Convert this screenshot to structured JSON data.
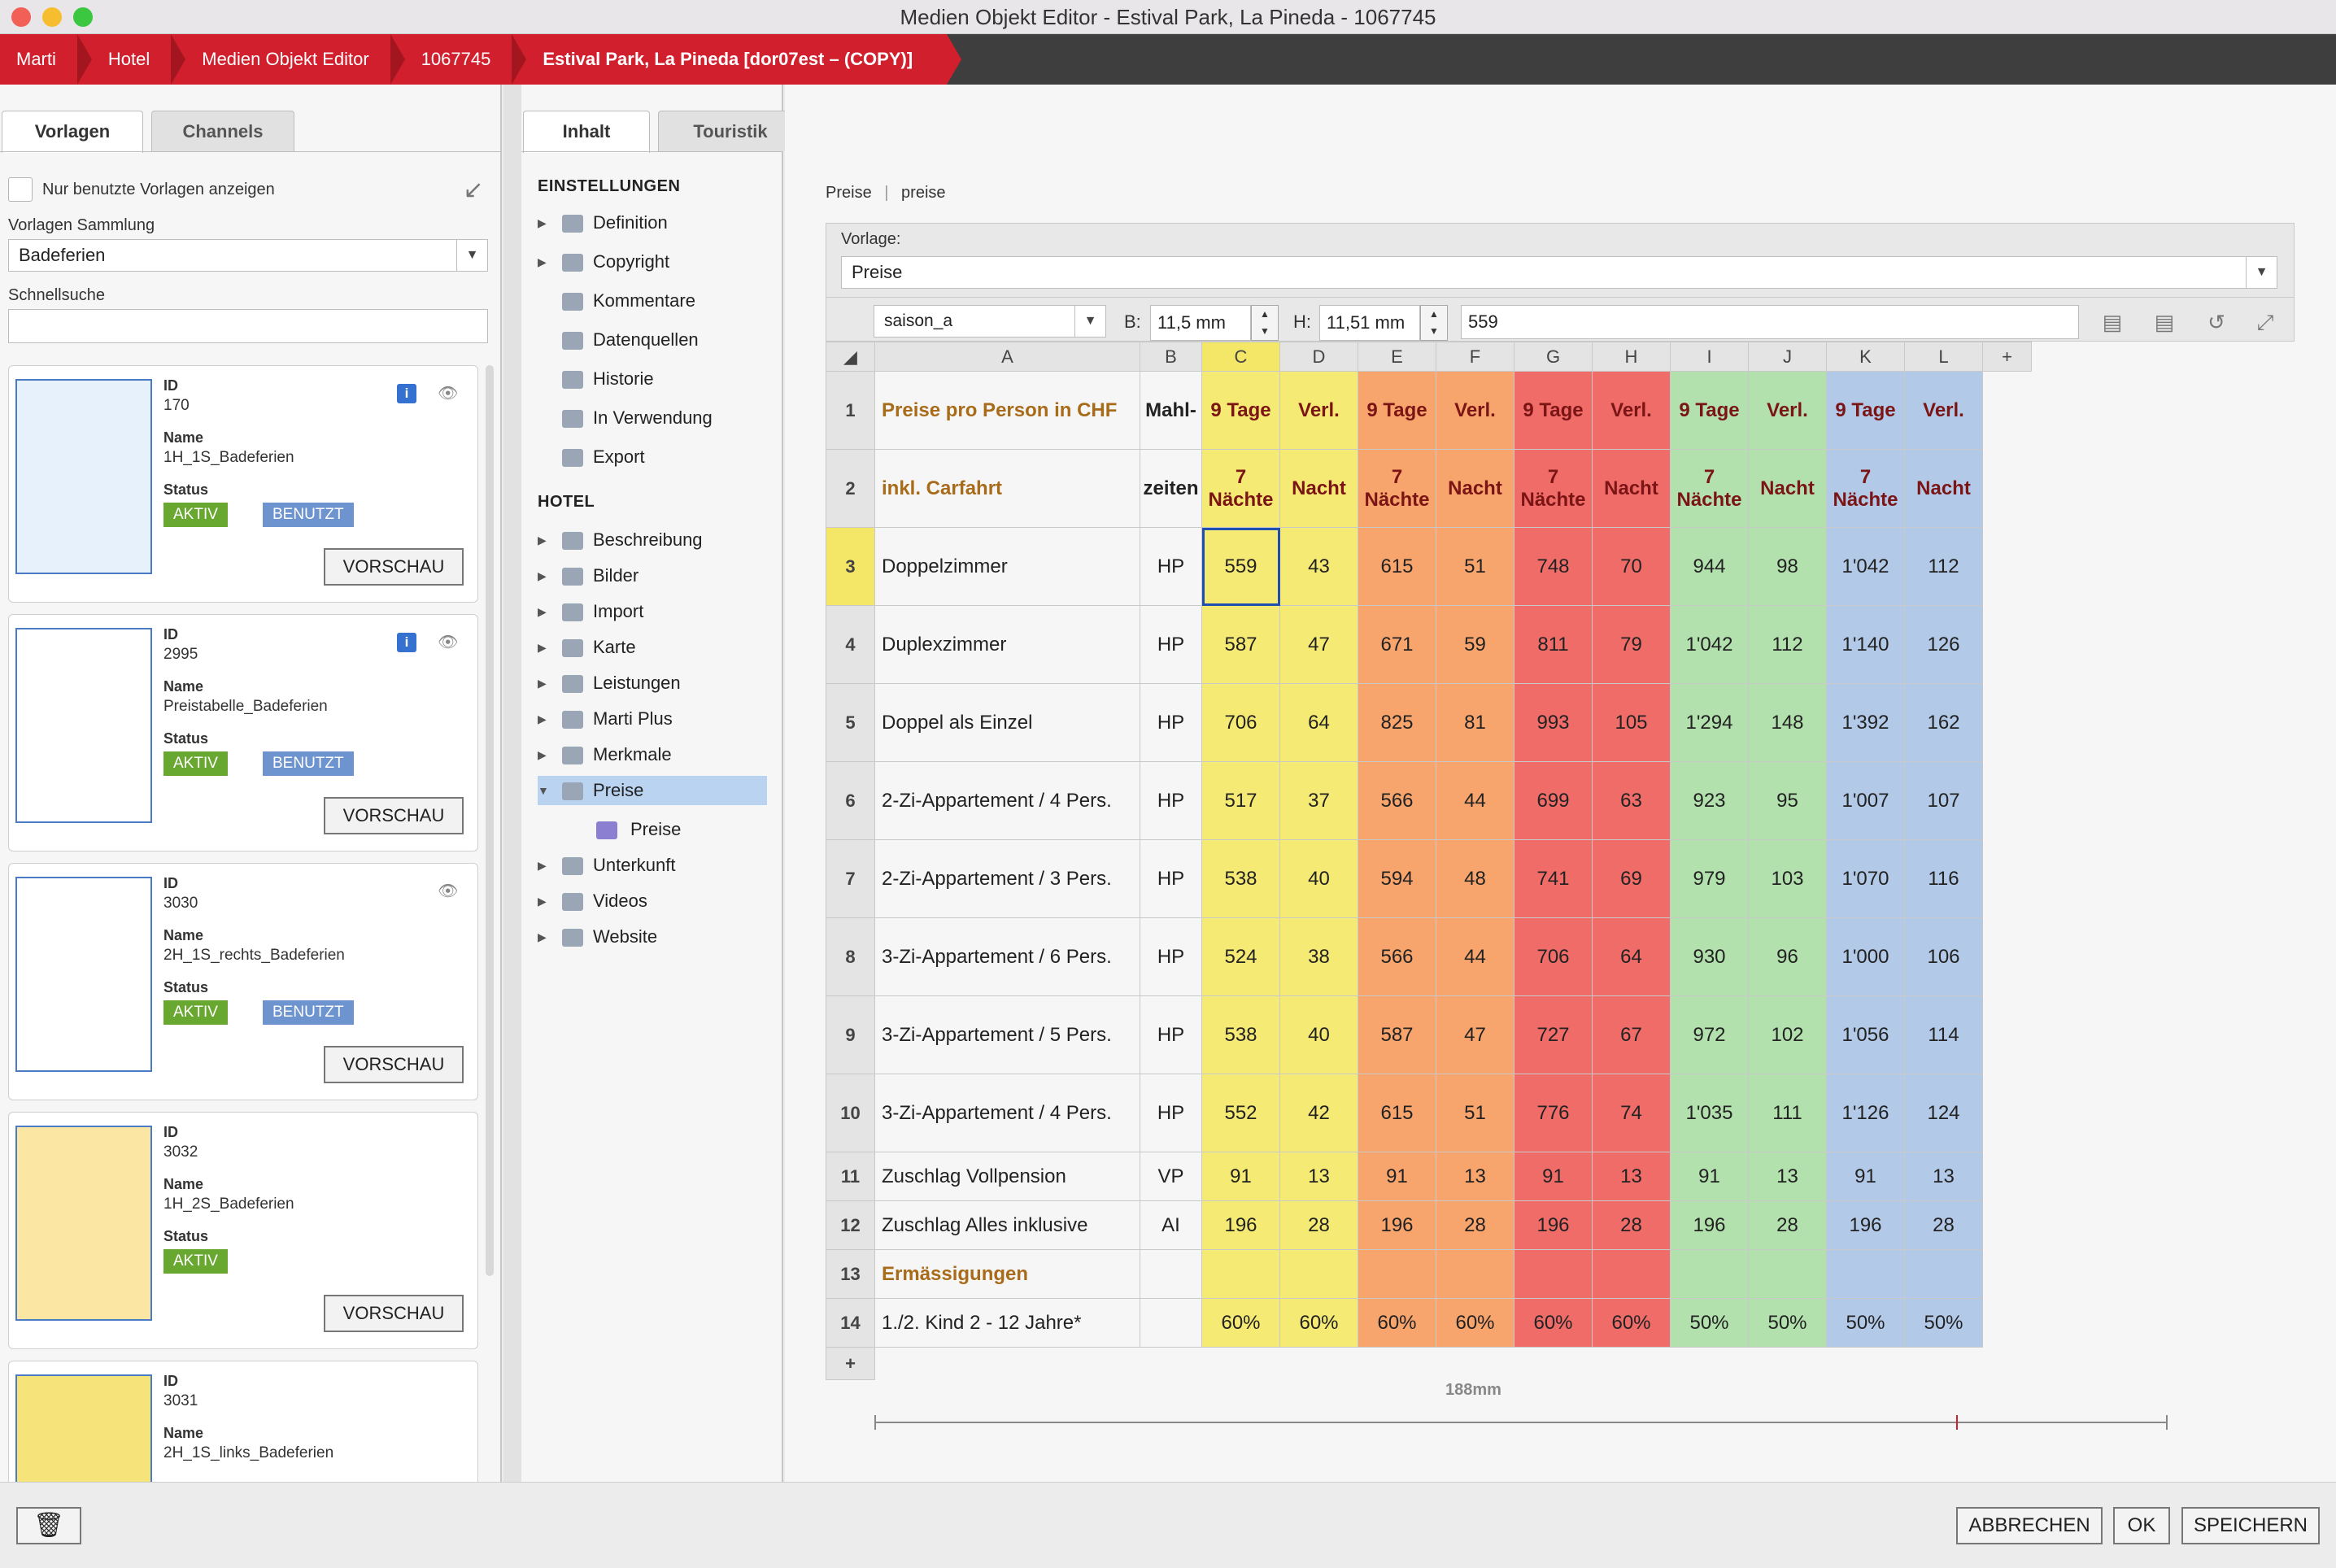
{
  "window": {
    "title": "Medien Objekt Editor - Estival Park, La Pineda - 1067745"
  },
  "breadcrumb": [
    "Marti",
    "Hotel",
    "Medien Objekt Editor",
    "1067745",
    "Estival Park, La Pineda [dor07est  – (COPY)]"
  ],
  "left": {
    "tabs": [
      "Vorlagen",
      "Channels"
    ],
    "only_used_label": "Nur benutzte Vorlagen anzeigen",
    "collection_label": "Vorlagen Sammlung",
    "collection_value": "Badeferien",
    "quicksearch_label": "Schnellsuche",
    "quicksearch_value": "",
    "field_labels": {
      "id": "ID",
      "name": "Name",
      "status": "Status"
    },
    "preview_label": "VORSCHAU",
    "cards": [
      {
        "id": "170",
        "name": "1H_1S_Badeferien",
        "status": [
          "AKTIV",
          "BENUTZT"
        ],
        "info": true
      },
      {
        "id": "2995",
        "name": "Preistabelle_Badeferien",
        "status": [
          "AKTIV",
          "BENUTZT"
        ],
        "info": true
      },
      {
        "id": "3030",
        "name": "2H_1S_rechts_Badeferien",
        "status": [
          "AKTIV",
          "BENUTZT"
        ],
        "info": false
      },
      {
        "id": "3032",
        "name": "1H_2S_Badeferien",
        "status": [
          "AKTIV"
        ],
        "info": false
      },
      {
        "id": "3031",
        "name": "2H_1S_links_Badeferien",
        "status": [],
        "info": false
      }
    ]
  },
  "middle": {
    "tabs": [
      "Inhalt",
      "Touristik"
    ],
    "section_settings": "EINSTELLUNGEN",
    "settings": [
      "Definition",
      "Copyright",
      "Kommentare",
      "Datenquellen",
      "Historie",
      "In Verwendung",
      "Export"
    ],
    "section_hotel": "HOTEL",
    "hotel": [
      "Beschreibung",
      "Bilder",
      "Import",
      "Karte",
      "Leistungen",
      "Marti Plus",
      "Merkmale",
      "Preise",
      "Unterkunft",
      "Videos",
      "Website"
    ],
    "selected": "Preise",
    "sub": "Preise"
  },
  "main": {
    "breadcrumb": [
      "Preise",
      "preise"
    ],
    "vorlage_label": "Vorlage:",
    "vorlage_value": "Preise",
    "cell_name": "saison_a",
    "width_label": "B:",
    "width_value": "11,5 mm",
    "height_label": "H:",
    "height_value": "11,51 mm",
    "formula": "559",
    "measure_label": "188mm",
    "columns": [
      "A",
      "B",
      "C",
      "D",
      "E",
      "F",
      "G",
      "H",
      "I",
      "J",
      "K",
      "L"
    ],
    "rows": [
      {
        "n": "1",
        "cells": [
          "Preise pro Person in CHF",
          "Mahl-",
          "9 Tage",
          "Verl.",
          "9 Tage",
          "Verl.",
          "9 Tage",
          "Verl.",
          "9 Tage",
          "Verl.",
          "9 Tage",
          "Verl."
        ]
      },
      {
        "n": "2",
        "cells": [
          "inkl. Carfahrt",
          "zeiten",
          "7 Nächte",
          "Nacht",
          "7 Nächte",
          "Nacht",
          "7 Nächte",
          "Nacht",
          "7 Nächte",
          "Nacht",
          "7 Nächte",
          "Nacht"
        ]
      },
      {
        "n": "3",
        "cells": [
          "Doppelzimmer",
          "HP",
          "559",
          "43",
          "615",
          "51",
          "748",
          "70",
          "944",
          "98",
          "1'042",
          "112"
        ]
      },
      {
        "n": "4",
        "cells": [
          "Duplexzimmer",
          "HP",
          "587",
          "47",
          "671",
          "59",
          "811",
          "79",
          "1'042",
          "112",
          "1'140",
          "126"
        ]
      },
      {
        "n": "5",
        "cells": [
          "Doppel als Einzel",
          "HP",
          "706",
          "64",
          "825",
          "81",
          "993",
          "105",
          "1'294",
          "148",
          "1'392",
          "162"
        ]
      },
      {
        "n": "6",
        "cells": [
          "2-Zi-Appartement / 4 Pers.",
          "HP",
          "517",
          "37",
          "566",
          "44",
          "699",
          "63",
          "923",
          "95",
          "1'007",
          "107"
        ]
      },
      {
        "n": "7",
        "cells": [
          "2-Zi-Appartement / 3 Pers.",
          "HP",
          "538",
          "40",
          "594",
          "48",
          "741",
          "69",
          "979",
          "103",
          "1'070",
          "116"
        ]
      },
      {
        "n": "8",
        "cells": [
          "3-Zi-Appartement / 6 Pers.",
          "HP",
          "524",
          "38",
          "566",
          "44",
          "706",
          "64",
          "930",
          "96",
          "1'000",
          "106"
        ]
      },
      {
        "n": "9",
        "cells": [
          "3-Zi-Appartement / 5 Pers.",
          "HP",
          "538",
          "40",
          "587",
          "47",
          "727",
          "67",
          "972",
          "102",
          "1'056",
          "114"
        ]
      },
      {
        "n": "10",
        "cells": [
          "3-Zi-Appartement / 4 Pers.",
          "HP",
          "552",
          "42",
          "615",
          "51",
          "776",
          "74",
          "1'035",
          "111",
          "1'126",
          "124"
        ]
      },
      {
        "n": "11",
        "cells": [
          "Zuschlag Vollpension",
          "VP",
          "91",
          "13",
          "91",
          "13",
          "91",
          "13",
          "91",
          "13",
          "91",
          "13"
        ]
      },
      {
        "n": "12",
        "cells": [
          "Zuschlag Alles inklusive",
          "AI",
          "196",
          "28",
          "196",
          "28",
          "196",
          "28",
          "196",
          "28",
          "196",
          "28"
        ]
      },
      {
        "n": "13",
        "cells": [
          "Ermässigungen",
          "",
          "",
          "",
          "",
          "",
          "",
          "",
          "",
          "",
          "",
          ""
        ]
      },
      {
        "n": "14",
        "cells": [
          "1./2. Kind 2 - 12 Jahre*",
          "",
          "60%",
          "60%",
          "60%",
          "60%",
          "60%",
          "60%",
          "50%",
          "50%",
          "50%",
          "50%"
        ]
      }
    ]
  },
  "footer": {
    "cancel": "ABBRECHEN",
    "ok": "OK",
    "save": "SPEICHERN"
  },
  "colors": {
    "accent_red": "#d21f2d",
    "yellow": "#f5ea73",
    "orange": "#f8a46d",
    "red": "#f06c69",
    "green": "#b2e1ae",
    "blue": "#b3c9e8"
  }
}
